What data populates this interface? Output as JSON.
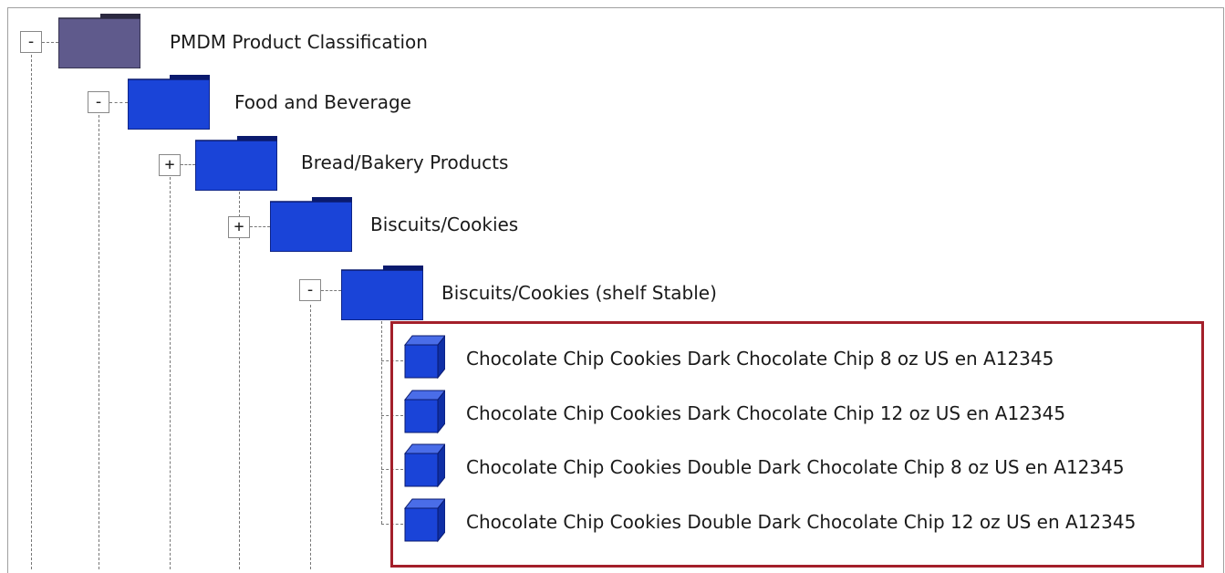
{
  "tree": {
    "root": {
      "label": "PMDM Product Classification",
      "expander": "-",
      "icon": "folder-icon",
      "icon_color": "#5f5a8c"
    },
    "level1": {
      "label": "Food and Beverage",
      "expander": "-",
      "icon": "folder-icon",
      "icon_color": "#1a44d8"
    },
    "level2": {
      "label": "Bread/Bakery Products",
      "expander": "+",
      "icon": "folder-icon",
      "icon_color": "#1a44d8"
    },
    "level3": {
      "label": "Biscuits/Cookies",
      "expander": "+",
      "icon": "folder-icon",
      "icon_color": "#1a44d8"
    },
    "level4": {
      "label": "Biscuits/Cookies (shelf Stable)",
      "expander": "-",
      "icon": "folder-icon",
      "icon_color": "#1a44d8"
    },
    "products": [
      {
        "label": "Chocolate Chip Cookies Dark Chocolate Chip 8 oz US en A12345",
        "icon": "product-cube-icon"
      },
      {
        "label": "Chocolate Chip Cookies Dark Chocolate Chip 12 oz US en A12345",
        "icon": "product-cube-icon"
      },
      {
        "label": "Chocolate Chip Cookies Double Dark Chocolate Chip 8 oz US en A12345",
        "icon": "product-cube-icon"
      },
      {
        "label": "Chocolate Chip Cookies Double Dark Chocolate Chip 12 oz US en A12345",
        "icon": "product-cube-icon"
      }
    ]
  },
  "colors": {
    "folder_blue": "#1a44d8",
    "root_folder": "#5f5a8c",
    "highlight_border": "#a31f2a",
    "cube_blue": "#1a44d8"
  }
}
